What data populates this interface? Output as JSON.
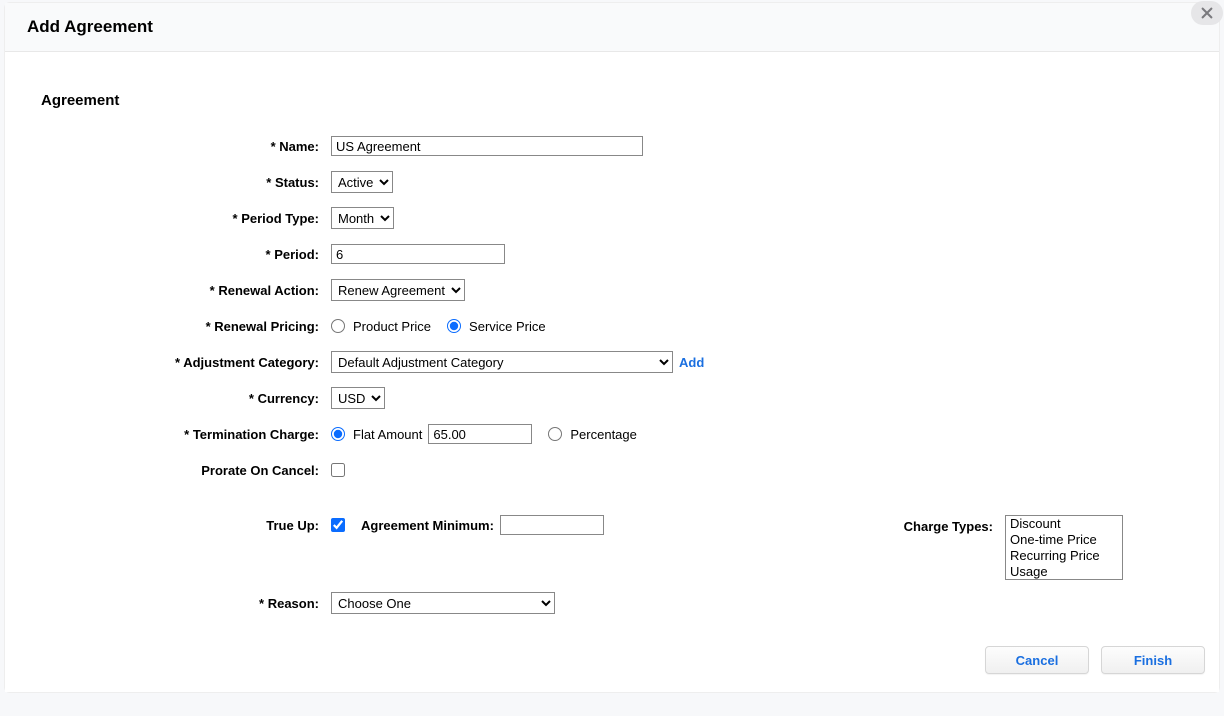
{
  "dialog": {
    "title": "Add Agreement",
    "section_title": "Agreement"
  },
  "labels": {
    "name": "Name:",
    "status": "Status:",
    "period_type": "Period Type:",
    "period": "Period:",
    "renewal_action": "Renewal Action:",
    "renewal_pricing": "Renewal Pricing:",
    "adjustment_category": "Adjustment Category:",
    "currency": "Currency:",
    "termination_charge": "Termination Charge:",
    "prorate_on_cancel": "Prorate On Cancel:",
    "true_up": "True Up:",
    "agreement_minimum": "Agreement Minimum:",
    "reason": "Reason:",
    "charge_types": "Charge Types:"
  },
  "values": {
    "name": "US Agreement",
    "status": "Active",
    "period_type": "Month",
    "period": "6",
    "renewal_action": "Renew Agreement",
    "renewal_pricing_product": "Product Price",
    "renewal_pricing_service": "Service Price",
    "adjustment_category": "Default Adjustment Category",
    "currency": "USD",
    "termination_flat_label": "Flat Amount",
    "termination_flat_value": "65.00",
    "termination_pct_label": "Percentage",
    "agreement_minimum": "",
    "reason": "Choose One",
    "add_link": "Add"
  },
  "options": {
    "status": [
      "Active"
    ],
    "period_type": [
      "Month"
    ],
    "renewal_action": [
      "Renew Agreement"
    ],
    "adjustment_category": [
      "Default Adjustment Category"
    ],
    "currency": [
      "USD"
    ],
    "reason": [
      "Choose One"
    ],
    "charge_types": [
      "Discount",
      "One-time Price",
      "Recurring Price",
      "Usage"
    ]
  },
  "buttons": {
    "cancel": "Cancel",
    "finish": "Finish"
  }
}
